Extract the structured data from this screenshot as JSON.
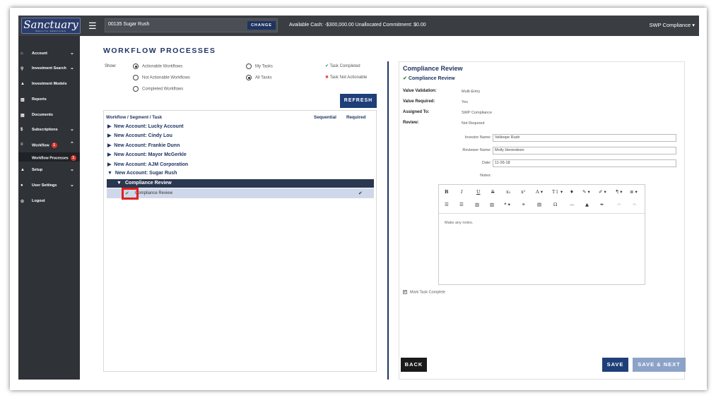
{
  "app": {
    "logo": "Sanctuary",
    "logo_sub": "WEALTH SERVICES"
  },
  "topbar": {
    "account": "00135 Sugar Rush",
    "change_label": "CHANGE",
    "cash_text": "Available Cash: -$300,000.00   Unallocated Commitment: $0.00",
    "user_menu": "SWP Compliance ▾"
  },
  "sidebar": {
    "items": [
      {
        "icon": "home-icon",
        "glyph": "⌂",
        "label": "Account",
        "chev": "⌄"
      },
      {
        "icon": "search-icon",
        "glyph": "⚲",
        "label": "Investment Search",
        "chev": "⌄"
      },
      {
        "icon": "models-icon",
        "glyph": "▲",
        "label": "Investment Models",
        "chev": ""
      },
      {
        "icon": "reports-icon",
        "glyph": "▥",
        "label": "Reports",
        "chev": ""
      },
      {
        "icon": "documents-icon",
        "glyph": "▤",
        "label": "Documents",
        "chev": ""
      },
      {
        "icon": "subscriptions-icon",
        "glyph": "$",
        "label": "Subscriptions",
        "chev": "⌄"
      },
      {
        "icon": "workflow-icon",
        "glyph": "≡",
        "label": "Workflow",
        "badge": "1",
        "chev": "⌃"
      },
      {
        "icon": "setup-icon",
        "glyph": "▲",
        "label": "Setup",
        "chev": "⌄"
      },
      {
        "icon": "user-settings-icon",
        "glyph": "●",
        "label": "User Settings",
        "chev": "⌄"
      },
      {
        "icon": "logout-icon",
        "glyph": "⊙",
        "label": "Logout",
        "chev": ""
      }
    ],
    "sub_item": {
      "label": "Workflow Processes",
      "badge": "1"
    }
  },
  "main": {
    "title": "WORKFLOW PROCESSES",
    "show_label": "Show:",
    "filters": [
      {
        "label": "Actionable Workflows",
        "checked": true
      },
      {
        "label": "Not Actionable Workflows",
        "checked": false
      },
      {
        "label": "Completed Workflows",
        "checked": false
      }
    ],
    "task_filters": [
      {
        "label": "My Tasks",
        "checked": false
      },
      {
        "label": "All Tasks",
        "checked": true
      }
    ],
    "legend": {
      "completed": "Task Completed",
      "not_actionable": "Task Not Actionable",
      "completed_color": "#2e8b3a",
      "not_actionable_color": "#d9342b"
    },
    "refresh_label": "REFRESH",
    "table": {
      "col_task": "Workflow / Segment / Task",
      "col_sequential": "Sequential",
      "col_required": "Required",
      "workflows": [
        "New Account: Lucky Account",
        "New Account: Cindy Lou",
        "New Account: Frankie Dunn",
        "New Account: Mayor McGerkle",
        "New Account: AJM Corporation",
        "New Account: Sugar Rush"
      ],
      "segment": "Compliance Review",
      "task": "Compliance Review",
      "task_required_mark": "✔"
    }
  },
  "review": {
    "title": "Compliance Review",
    "subtitle": "Compliance Review",
    "fields": [
      {
        "key": "Value Validation:",
        "value": "Multi-Entry"
      },
      {
        "key": "Value Required:",
        "value": "Yes"
      },
      {
        "key": "Assigned To:",
        "value": "SWP Compliance"
      },
      {
        "key": "Review:",
        "value": "Not Required"
      }
    ],
    "form": {
      "investor_label": "Investor Name:",
      "investor_value": "Velleope Rush",
      "reviewer_label": "Reviewer Name:",
      "reviewer_value": "Molly Herendeen",
      "date_label": "Date:",
      "date_value": "11-26-18",
      "notes_label": "Notes:",
      "notes_placeholder": "Make any notes."
    },
    "toolbar_row1": [
      "B",
      "I",
      "U",
      "S",
      "x₂",
      "x²",
      "A ▾",
      "T↕ ▾",
      "♦",
      "✎ ▾",
      "✐ ▾",
      "¶ ▾",
      "≣ ▾"
    ],
    "toolbar_row2": [
      "☰",
      "☰",
      "▥",
      "▥",
      "❝ ▾",
      "⚭",
      "▤",
      "Ω",
      "—",
      "▲",
      "✒",
      "↶",
      "↷"
    ],
    "mark_complete": "Mark Task Complete",
    "back_label": "BACK",
    "save_label": "SAVE",
    "save_next_label": "SAVE & NEXT"
  }
}
